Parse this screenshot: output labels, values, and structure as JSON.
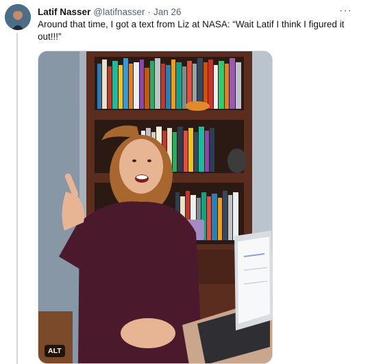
{
  "tweet": {
    "author_name": "Latif Nasser",
    "author_handle": "@latifnasser",
    "separator": "·",
    "date": "Jan 26",
    "more_glyph": "···",
    "text": "Around that time, I got a text from Liz at NASA: “Wait Latif I think I figured it out!!!”",
    "media": {
      "alt_badge": "ALT"
    }
  }
}
